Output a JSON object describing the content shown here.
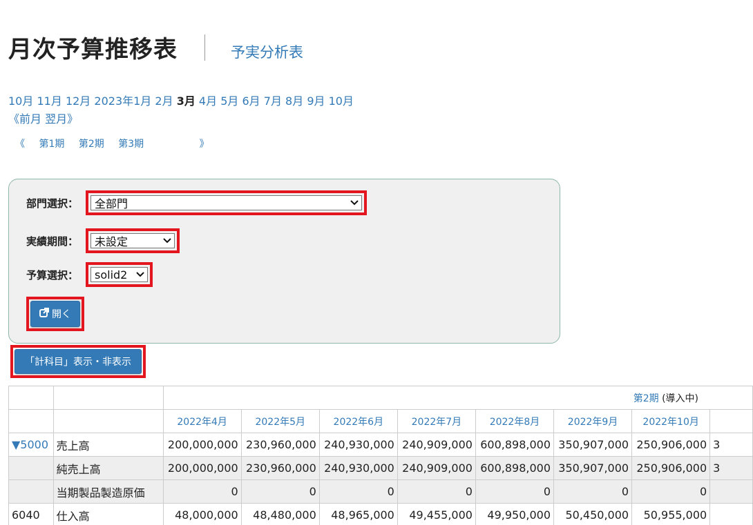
{
  "header": {
    "title": "月次予算推移表",
    "sub_link": "予実分析表"
  },
  "month_nav": {
    "months": [
      "10月",
      "11月",
      "12月",
      "2023年1月",
      "2月",
      "3月",
      "4月",
      "5月",
      "6月",
      "7月",
      "8月",
      "9月",
      "10月"
    ],
    "current_index": 5,
    "prev_label": "《前月",
    "next_label": "翌月》"
  },
  "period_nav": {
    "prev_symbol": "《",
    "periods": [
      "第1期",
      "第2期",
      "第3期"
    ],
    "next_symbol": "》"
  },
  "form": {
    "dept_label": "部門選択：",
    "dept_value": "全部門",
    "actual_label": "実績期間：",
    "actual_value": "未設定",
    "budget_label": "予算選択：",
    "budget_value": "solid2",
    "open_label": "開く",
    "toggle_label": "「計科目」表示・非表示"
  },
  "icons": {
    "open": "external-link-icon",
    "select": "chevron-down-icon"
  },
  "colors": {
    "link": "#337ab7",
    "button": "#337ab7",
    "highlight_box": "#e3161f",
    "panel_bg": "#f0f0f0",
    "panel_border": "#8fb7a8",
    "row_gray": "#eeeeee"
  },
  "table": {
    "period_link": "第2期",
    "period_note": " (導入中)",
    "months": [
      "2022年4月",
      "2022年5月",
      "2022年6月",
      "2022年7月",
      "2022年8月",
      "2022年9月",
      "2022年10月"
    ],
    "rows": [
      {
        "code": "▼5000",
        "name": "売上高",
        "values": [
          "200,000,000",
          "230,960,000",
          "240,930,000",
          "240,909,000",
          "600,898,000",
          "350,907,000",
          "250,906,000"
        ],
        "partial": "3"
      },
      {
        "code": "",
        "name": "純売上高",
        "values": [
          "200,000,000",
          "230,960,000",
          "240,930,000",
          "240,909,000",
          "600,898,000",
          "350,907,000",
          "250,906,000"
        ],
        "partial": "3"
      },
      {
        "code": "",
        "name": "当期製品製造原価",
        "values": [
          "0",
          "0",
          "0",
          "0",
          "0",
          "0",
          "0"
        ],
        "partial": ""
      },
      {
        "code": "6040",
        "name": "仕入高",
        "values": [
          "48,000,000",
          "48,480,000",
          "48,965,000",
          "49,455,000",
          "49,950,000",
          "50,450,000",
          "50,955,000"
        ],
        "partial": ""
      }
    ]
  }
}
